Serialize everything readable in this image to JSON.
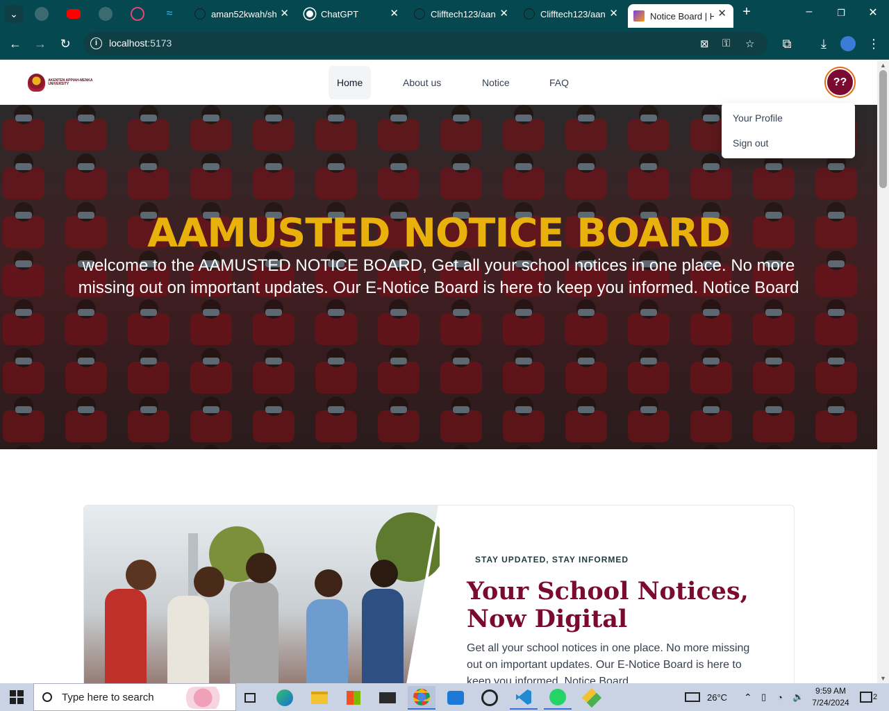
{
  "browser": {
    "tabs": [
      {
        "title": "aman52kwah/sh",
        "close": "✕"
      },
      {
        "title": "ChatGPT",
        "close": "✕"
      },
      {
        "title": "Clifftech123/aan",
        "close": "✕"
      },
      {
        "title": "Clifftech123/aan",
        "close": "✕"
      },
      {
        "title": "Notice Board | H",
        "close": "✕"
      }
    ],
    "new_tab": "+",
    "url_host": "localhost",
    "url_port": ":5173"
  },
  "site": {
    "logo_text": "AKENTEN APPIAH-MENKA UNIVERSITY",
    "nav": [
      "Home",
      "About us",
      "Notice",
      "FAQ"
    ],
    "avatar_text": "??",
    "dropdown": [
      "Your Profile",
      "Sign out"
    ]
  },
  "hero": {
    "title": "AAMUSTED NOTICE BOARD",
    "subtitle": "welcome to the AAMUSTED NOTICE BOARD, Get all your school notices in one place. No more missing out on important updates. Our E-Notice Board is here to keep you informed. Notice Board"
  },
  "feature": {
    "eyebrow": "STAY UPDATED, STAY INFORMED",
    "title": "Your School Notices, Now Digital",
    "text": "Get all your school notices in one place. No more missing out on important updates. Our E-Notice Board is here to keep you informed. Notice Board"
  },
  "taskbar": {
    "search_placeholder": "Type here to search",
    "weather": "26°C",
    "time": "9:59 AM",
    "date": "7/24/2024",
    "notifications": "2"
  },
  "colors": {
    "chrome": "#05484f",
    "brand_maroon": "#7a0a30",
    "hero_gold": "#e8b10c"
  }
}
